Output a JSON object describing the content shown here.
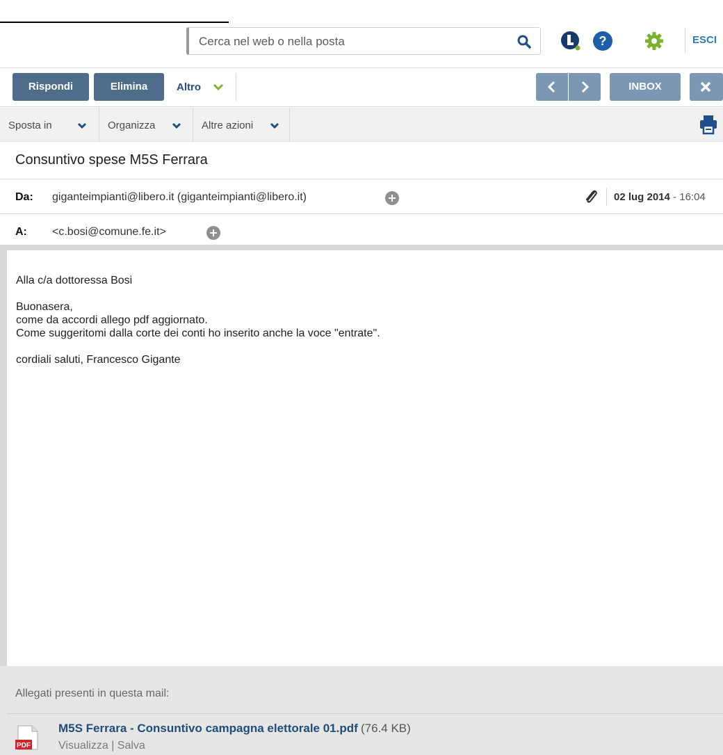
{
  "header": {
    "search_placeholder": "Cerca nel web o nella posta",
    "search_icon": "search-icon",
    "libero_icon": "libero-logo-icon",
    "help_icon": "help-icon",
    "settings_icon": "gear-icon",
    "logout_label": "ESCI"
  },
  "toolbar": {
    "reply_label": "Rispondi",
    "delete_label": "Elimina",
    "more_label": "Altro",
    "prev_icon": "chevron-left-icon",
    "next_icon": "chevron-right-icon",
    "inbox_label": "INBOX",
    "close_icon": "close-icon"
  },
  "menubar": {
    "items": [
      {
        "label": "Sposta in"
      },
      {
        "label": "Organizza"
      },
      {
        "label": "Altre azioni"
      }
    ],
    "print_icon": "printer-icon"
  },
  "message": {
    "subject": "Consuntivo spese M5S Ferrara",
    "from_label": "Da:",
    "from_value": "giganteimpianti@libero.it (giganteimpianti@libero.it)",
    "to_label": "A:",
    "to_value": "<c.bosi@comune.fe.it>",
    "date_bold": "02 lug 2014",
    "date_rest": " - 16:04",
    "attachment_icon": "paperclip-icon",
    "body": [
      "Alla c/a dottoressa Bosi",
      "",
      "Buonasera,",
      "come da accordi allego pdf aggiornato.",
      "Come suggeritomi dalla corte dei conti ho inserito anche la voce \"entrate\".",
      "",
      "cordiali saluti, Francesco Gigante"
    ]
  },
  "attachments": {
    "title": "Allegati presenti in questa mail:",
    "items": [
      {
        "name": "M5S Ferrara - Consuntivo campagna elettorale 01.pdf",
        "size": "(76.4 KB)",
        "icon_label": "PDF",
        "view_label": "Visualizza",
        "separator": " | ",
        "save_label": "Salva"
      }
    ]
  },
  "colors": {
    "button_dark": "#4d6d8a",
    "button_light": "#7b97b4",
    "link_blue": "#1f4c7c",
    "accent_green": "#7bb32e"
  }
}
